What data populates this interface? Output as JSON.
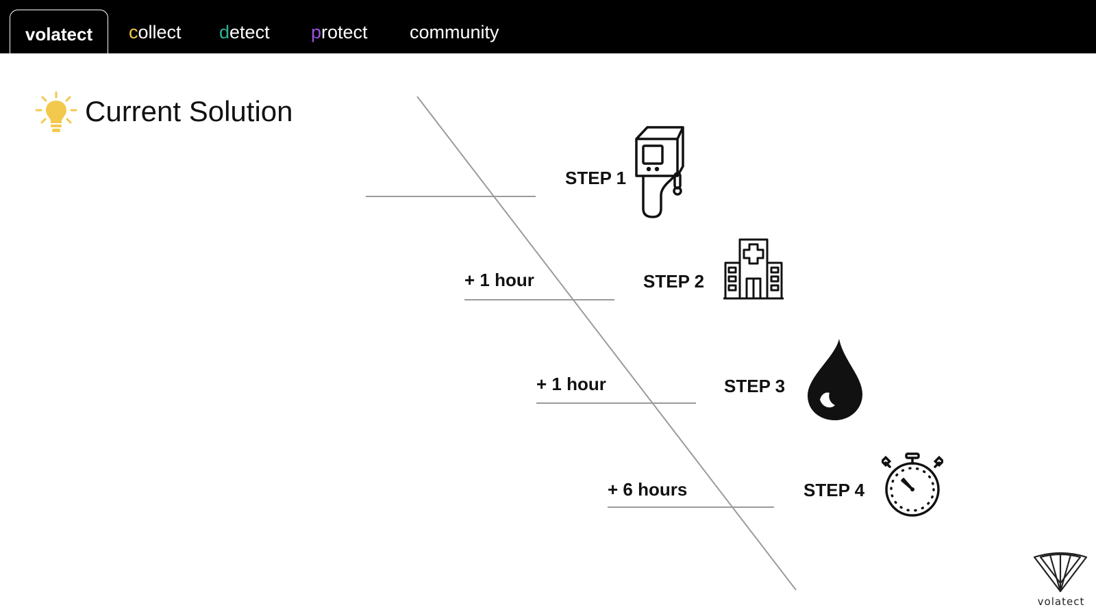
{
  "nav": {
    "tabs": [
      {
        "id": "volatect",
        "label": "volatect",
        "active": true
      },
      {
        "id": "collect",
        "first": "c",
        "rest": "ollect",
        "accent": "#f2c94c"
      },
      {
        "id": "detect",
        "first": "d",
        "rest": "etect",
        "accent": "#2bb39a"
      },
      {
        "id": "protect",
        "first": "p",
        "rest": "rotect",
        "accent": "#9b51e0"
      },
      {
        "id": "community",
        "label": "community"
      }
    ]
  },
  "page": {
    "title": "Current Solution",
    "title_icon": "lightbulb-icon",
    "title_icon_color": "#f2c94c"
  },
  "timeline": {
    "steps": [
      {
        "label": "STEP 1",
        "delay": "",
        "icon": "thermometer-device-icon"
      },
      {
        "label": "STEP 2",
        "delay": "+ 1 hour",
        "icon": "hospital-icon"
      },
      {
        "label": "STEP 3",
        "delay": "+ 1 hour",
        "icon": "blood-drop-icon"
      },
      {
        "label": "STEP 4",
        "delay": "+ 6 hours",
        "icon": "stopwatch-icon"
      }
    ]
  },
  "brand": {
    "name": "volatect",
    "icon": "shield-logo-icon"
  },
  "colors": {
    "nav_bg": "#000000",
    "line": "#9a9a9a",
    "text": "#111111"
  }
}
